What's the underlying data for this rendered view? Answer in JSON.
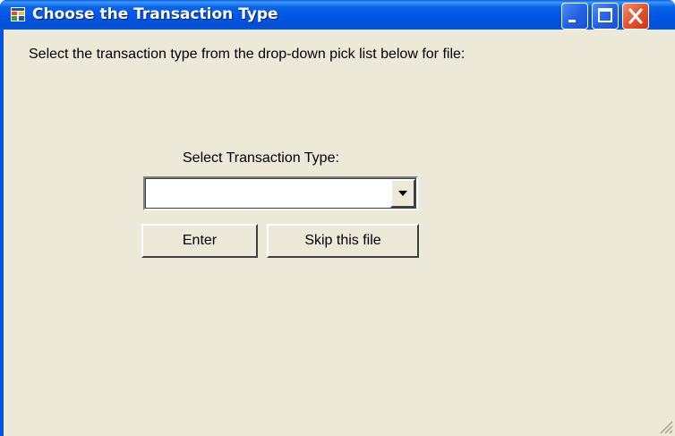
{
  "window": {
    "title": "Choose the Transaction Type",
    "controls": {
      "minimize": "minimize-icon",
      "maximize": "maximize-icon",
      "close": "close-icon"
    }
  },
  "dialog": {
    "instruction": "Select the transaction type from the drop-down pick list below for file:",
    "select_label": "Select Transaction Type:",
    "transaction_type": {
      "value": ""
    },
    "buttons": {
      "enter": "Enter",
      "skip": "Skip this file"
    }
  },
  "colors": {
    "titlebar": "#0054e3",
    "client": "#ece9d8",
    "close_button": "#e2542f"
  }
}
